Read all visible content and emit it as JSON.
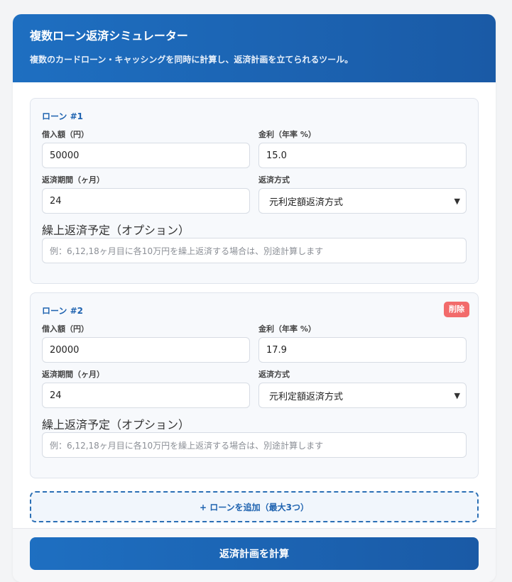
{
  "header": {
    "title": "複数ローン返済シミュレーター",
    "subtitle": "複数のカードローン・キャッシングを同時に計算し、返済計画を立てられるツール。"
  },
  "labels": {
    "amount": "借入額（円）",
    "rate": "金利（年率 %）",
    "term": "返済期間（ヶ月）",
    "method": "返済方式",
    "prepay": "繰上返済予定（オプション）"
  },
  "loans": [
    {
      "title": "ローン #1",
      "amount": "50000",
      "rate": "15.0",
      "term": "24",
      "method": "元利定額返済方式",
      "prepay_placeholder": "例：6,12,18ヶ月目に各10万円を繰上返済する場合は、別途計算します"
    },
    {
      "title": "ローン #2",
      "delete_label": "削除",
      "amount": "20000",
      "rate": "17.9",
      "term": "24",
      "method": "元利定額返済方式",
      "prepay_placeholder": "例：6,12,18ヶ月目に各10万円を繰上返済する場合は、別途計算します"
    }
  ],
  "add_button": "+ ローンを追加（最大3つ）",
  "calc_button": "返済計画を計算",
  "colors": {
    "accent": "#1e6fc1",
    "delete": "#f26b6b"
  },
  "icons": {
    "select_chevron": "chevron-down-icon"
  }
}
